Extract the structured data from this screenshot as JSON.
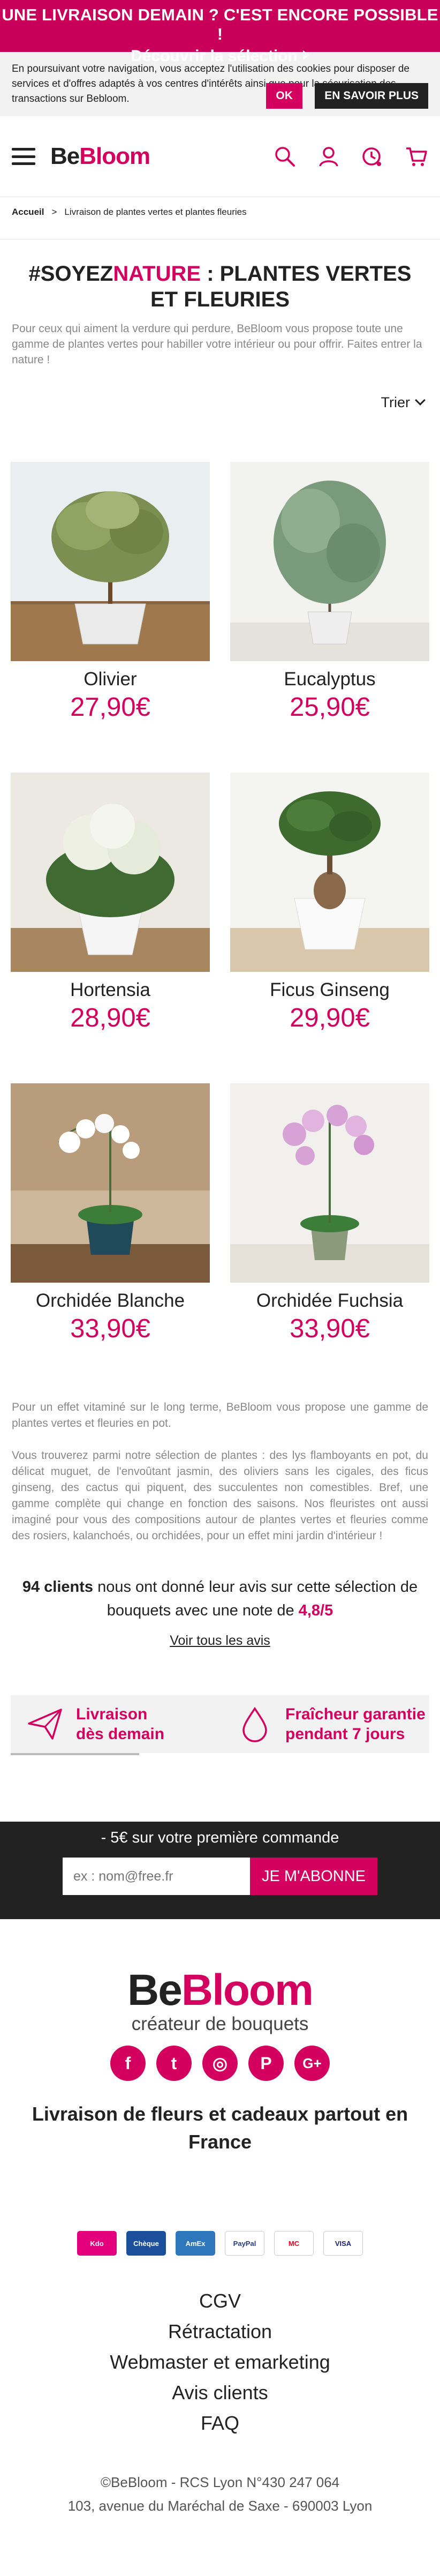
{
  "promo": {
    "line1": "UNE LIVRAISON DEMAIN ? C'EST ENCORE POSSIBLE !",
    "line2": "Découvrir la sélection"
  },
  "cookie": {
    "text": "En poursuivant votre navigation, vous acceptez l'utilisation des cookies pour disposer de services et d'offres adaptés à vos centres d'intérêts ainsi que pour la sécurisation des transactions sur Bebloom.",
    "ok_label": "OK",
    "more_label": "EN SAVOIR PLUS"
  },
  "header": {
    "logo_part1": "Be",
    "logo_part2": "Bloom",
    "icons": [
      "search-icon",
      "user-icon",
      "delivery-icon",
      "cart-icon"
    ]
  },
  "breadcrumb": {
    "home": "Accueil",
    "separator": ">",
    "current": "Livraison de plantes vertes et plantes fleuries"
  },
  "page": {
    "title_hash": "#SOYEZ",
    "title_accent": "NATURE",
    "title_rest": " : PLANTES VERTES ET FLEURIES",
    "intro": "Pour ceux qui aiment la verdure qui perdure, BeBloom vous propose toute une gamme de plantes vertes pour habiller votre intérieur ou pour offrir. Faites entrer la nature !",
    "sort_label": "Trier"
  },
  "products": [
    {
      "name": "Olivier",
      "price": "27,90€"
    },
    {
      "name": "Eucalyptus",
      "price": "25,90€"
    },
    {
      "name": "Hortensia",
      "price": "28,90€"
    },
    {
      "name": "Ficus Ginseng",
      "price": "29,90€"
    },
    {
      "name": "Orchidée Blanche",
      "price": "33,90€"
    },
    {
      "name": "Orchidée Fuchsia",
      "price": "33,90€"
    }
  ],
  "description": {
    "p1": "Pour un effet vitaminé sur le long terme, BeBloom vous propose une gamme de plantes vertes et fleuries en pot.",
    "p2": "Vous trouverez parmi notre sélection de plantes : des lys flamboyants en pot, du délicat muguet, de l'envoûtant jasmin, des oliviers sans les cigales, des ficus ginseng, des cactus qui piquent, des succulentes non comestibles. Bref, une gamme complète qui change en fonction des saisons. Nos fleuristes ont aussi imaginé pour vous des compositions autour de plantes vertes et fleuries comme des rosiers, kalanchoés, ou orchidées, pour un effet mini jardin d'intérieur !"
  },
  "reviews": {
    "count": "94 clients",
    "text1": " nous ont donné leur avis sur cette sélection de bouquets avec une note de ",
    "note": "4,8/5",
    "link": "Voir tous les avis"
  },
  "guarantees": {
    "delivery_line1": "Livraison",
    "delivery_line2": "dès demain",
    "fresh_line1": "Fraîcheur garantie",
    "fresh_line2": "pendant 7 jours"
  },
  "newsletter": {
    "title": "- 5€ sur votre première commande",
    "placeholder": "ex : nom@free.fr",
    "button": "JE M'ABONNE"
  },
  "footer": {
    "logo_part1": "Be",
    "logo_part2": "Bloom",
    "tagline": "créateur de bouquets",
    "socials": [
      "f",
      "t",
      "◎",
      "P",
      "G+"
    ],
    "title": "Livraison de fleurs et cadeaux partout en France",
    "payments": [
      "Kdo",
      "Chèque",
      "AmEx",
      "PayPal",
      "MC",
      "VISA"
    ],
    "links": [
      "CGV",
      "Rétractation",
      "Webmaster et emarketing",
      "Avis clients",
      "FAQ"
    ],
    "legal1": "©BeBloom - RCS Lyon N°430 247 064",
    "legal2": "103, avenue du Maréchal de Saxe - 690003 Lyon"
  },
  "colors": {
    "brand": "#d3005f",
    "promo_bg": "#c8005a",
    "dark": "#222222"
  }
}
